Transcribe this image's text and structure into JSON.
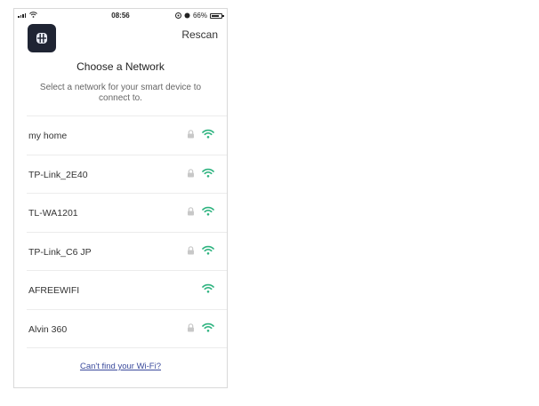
{
  "status": {
    "time": "08:56",
    "battery": "66%"
  },
  "header": {
    "rescan_label": "Rescan",
    "app_icon": "app-logo-icon"
  },
  "title": "Choose a Network",
  "subtitle": "Select a network for your smart device to connect to.",
  "networks": [
    {
      "name": "my home",
      "locked": true
    },
    {
      "name": "TP-Link_2E40",
      "locked": true
    },
    {
      "name": "TL-WA1201",
      "locked": true
    },
    {
      "name": "TP-Link_C6 JP",
      "locked": true
    },
    {
      "name": "AFREEWIFI",
      "locked": false
    },
    {
      "name": "Alvin 360",
      "locked": true
    }
  ],
  "footer": {
    "link_label": "Can't find your Wi-Fi?"
  },
  "colors": {
    "wifi": "#2db37f",
    "lock": "#c8c8c8",
    "link": "#3a4a9c",
    "icon_bg": "#1f2433"
  }
}
